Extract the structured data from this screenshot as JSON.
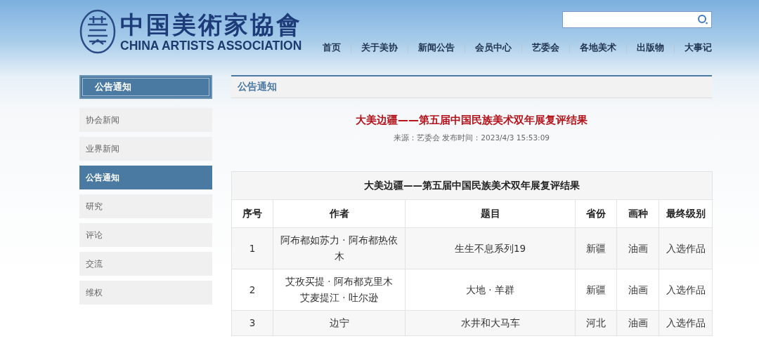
{
  "header": {
    "logo_cn": "中国美術家協會",
    "logo_en": "CHINA ARTISTS ASSOCIATION",
    "nav": [
      "首页",
      "关于美协",
      "新闻公告",
      "会员中心",
      "艺委会",
      "各地美术",
      "出版物",
      "大事记"
    ]
  },
  "sidebar": {
    "title": "公告通知",
    "items": [
      {
        "label": "协会新闻",
        "selected": false
      },
      {
        "label": "业界新闻",
        "selected": false
      },
      {
        "label": "公告通知",
        "selected": true
      },
      {
        "label": "研究",
        "selected": false
      },
      {
        "label": "评论",
        "selected": false
      },
      {
        "label": "交流",
        "selected": false
      },
      {
        "label": "维权",
        "selected": false
      }
    ]
  },
  "main": {
    "section_title": "公告通知",
    "article_title": "大美边疆——第五届中国民族美术双年展复评结果",
    "meta": "来源：艺委会 发布时间：2023/4/3 15:53:09",
    "table": {
      "caption": "大美边疆——第五届中国民族美术双年展复评结果",
      "columns": [
        "序号",
        "作者",
        "题目",
        "省份",
        "画种",
        "最终级别"
      ],
      "rows": [
        {
          "no": "1",
          "authors": [
            "阿布都如苏力 · 阿布都热依木"
          ],
          "title": "生生不息系列19",
          "province": "新疆",
          "medium": "油画",
          "level": "入选作品"
        },
        {
          "no": "2",
          "authors": [
            "艾孜买提 · 阿布都克里木",
            "艾麦提江 · 吐尔逊"
          ],
          "title": "大地 · 羊群",
          "province": "新疆",
          "medium": "油画",
          "level": "入选作品"
        },
        {
          "no": "3",
          "authors": [
            "边宁"
          ],
          "title": "水井和大马车",
          "province": "河北",
          "medium": "油画",
          "level": "入选作品"
        }
      ]
    }
  }
}
